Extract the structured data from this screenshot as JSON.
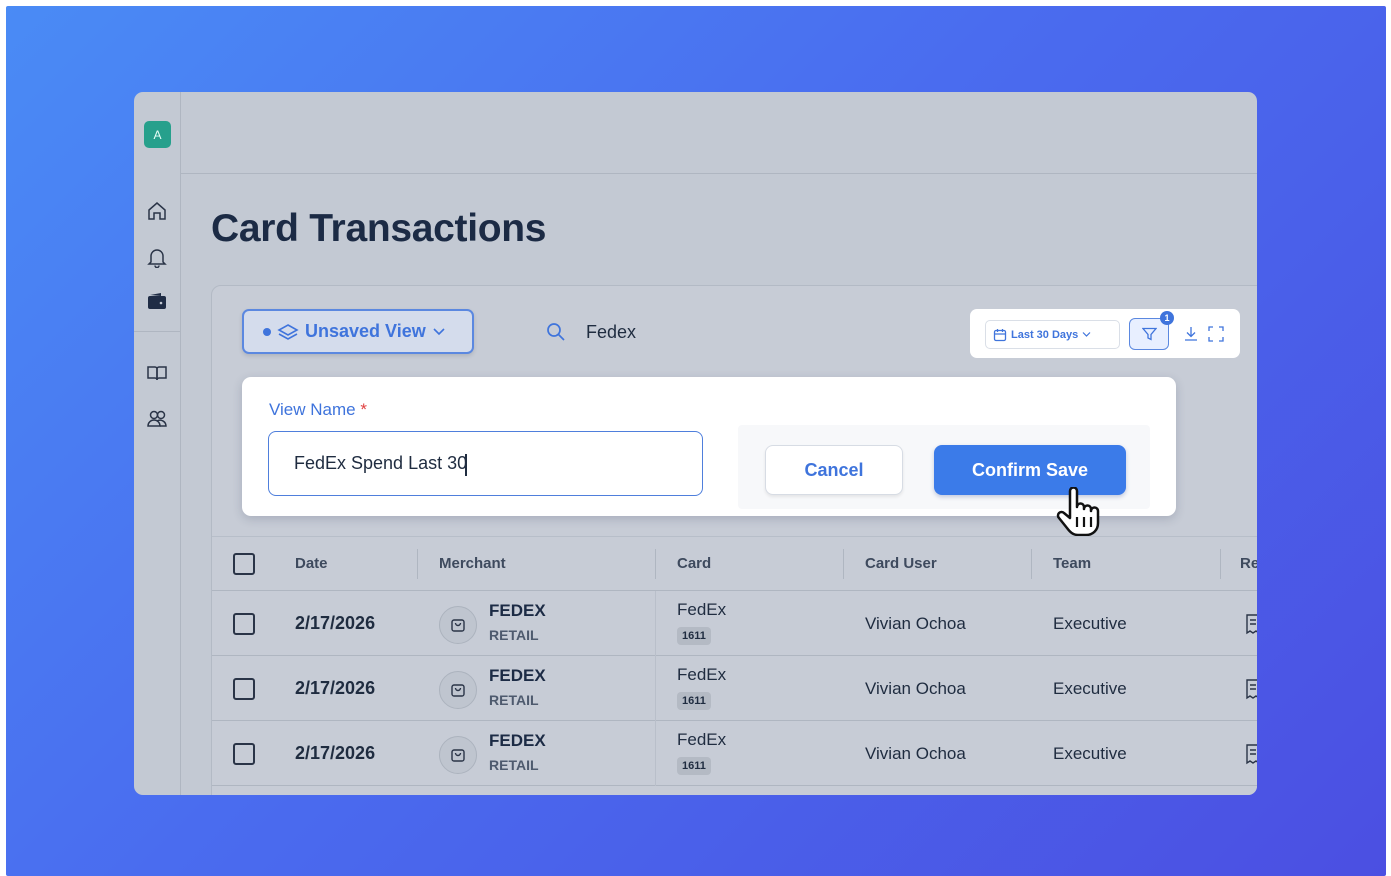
{
  "app": {
    "avatar_letter": "A",
    "page_title": "Card Transactions"
  },
  "sidebar": {
    "icons": [
      "home-icon",
      "bell-icon",
      "wallet-icon",
      "book-icon",
      "users-icon"
    ]
  },
  "toolbar": {
    "view_label": "Unsaved View",
    "search_value": "Fedex",
    "date_range_label": "Last 30 Days",
    "filter_count": "1"
  },
  "save_view": {
    "field_label": "View Name",
    "required_mark": "*",
    "input_value": "FedEx Spend Last 30",
    "cancel_label": "Cancel",
    "confirm_label": "Confirm Save"
  },
  "table": {
    "columns": [
      "Date",
      "Merchant",
      "Card",
      "Card User",
      "Team",
      "Re"
    ],
    "rows": [
      {
        "date": "2/17/2026",
        "merchant": "FEDEX",
        "category": "RETAIL",
        "card": "FedEx",
        "card_last4": "1611",
        "user": "Vivian Ochoa",
        "team": "Executive"
      },
      {
        "date": "2/17/2026",
        "merchant": "FEDEX",
        "category": "RETAIL",
        "card": "FedEx",
        "card_last4": "1611",
        "user": "Vivian Ochoa",
        "team": "Executive"
      },
      {
        "date": "2/17/2026",
        "merchant": "FEDEX",
        "category": "RETAIL",
        "card": "FedEx",
        "card_last4": "1611",
        "user": "Vivian Ochoa",
        "team": "Executive"
      }
    ]
  },
  "colors": {
    "accent": "#3b7be9",
    "backdrop_start": "#4a8bf5",
    "backdrop_end": "#4b4fe2",
    "avatar": "#26a08c"
  }
}
